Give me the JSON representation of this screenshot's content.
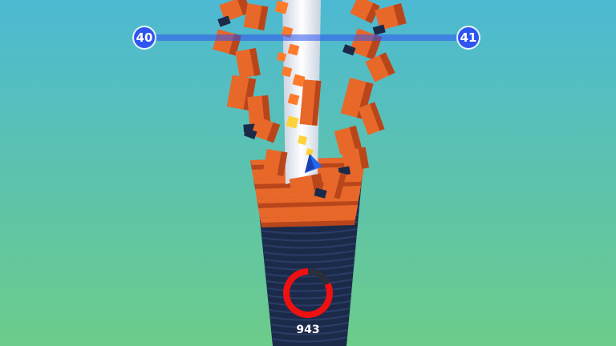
{
  "hud": {
    "current_level": "40",
    "next_level": "41",
    "level_progress": 0.38,
    "score": "943",
    "power_meter_fraction": 0.82
  },
  "colors": {
    "sky_top": "#4db9d3",
    "sky_bottom": "#6ccc8a",
    "accent_blue": "#2f55f0",
    "tower_orange": "#e8682a",
    "tower_orange_dark": "#b8461a",
    "tower_dark": "#1c2a4a",
    "tower_dark_edge": "#2a3d66",
    "pole_white": "#e8eef6",
    "ring_red": "#ee1111",
    "ring_dark": "#2a2f3a",
    "ball_blue": "#2268f0",
    "trail_orange": "#ff7a2a",
    "trail_yellow": "#ffd23a"
  },
  "icons": {
    "player": "ball-icon",
    "meter": "power-ring-icon"
  }
}
